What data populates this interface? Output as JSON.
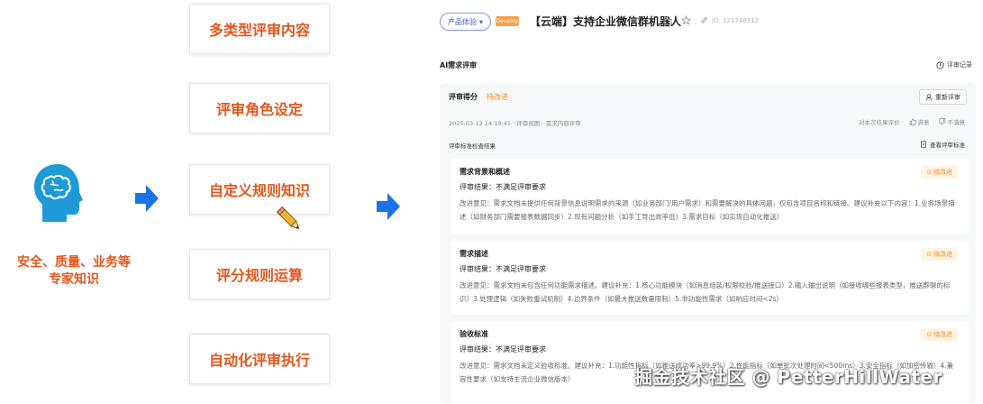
{
  "left": {
    "expert_text": "安全、质量、业务等\n专家知识",
    "steps": [
      "多类型评审内容",
      "评审角色设定",
      "自定义规则知识",
      "评分规则运算",
      "自动化评审执行"
    ]
  },
  "header": {
    "product_tag": "产品体验",
    "status_tag": "Develop",
    "title": "【云端】支持企业微信群机器人",
    "id_text": "ID: 121748312"
  },
  "section": {
    "title": "AI需求评审",
    "history_label": "评审记录"
  },
  "card": {
    "score_label": "评审得分",
    "score_value": "待改进",
    "rerun_label": "重新评审",
    "meta": "2025-03-12 14:19:41 · 评审视图：需求内容评审",
    "feedback_prompt": "对本次结果评价",
    "like_label": "满意",
    "dislike_label": "不满意",
    "check_title": "评审标准检查结果",
    "view_std_label": "查看评审标准"
  },
  "issues": [
    {
      "name": "需求背景和概述",
      "badge": "待改进",
      "result": "评审结果：不满足评审要求",
      "advice": "改进意见：需求文档未提供任何背景信息说明需求的来源（如业务部门/用户需求）和需要解决的具体问题，仅包含项目名称和链接。建议补充以下内容：1.业务场景描述（如财务部门需要报表数据同步）2.现有问题分析（如手工导出效率低）3.需求目标（如实现自动化推送）"
    },
    {
      "name": "需求描述",
      "badge": "待改进",
      "result": "评审结果：不满足评审要求",
      "advice": "改进意见：需求文档未包含任何功能需求描述。建议补充：1.核心功能模块（如消息组装/权限校验/推送接口）2.输入输出说明（如接收哪些报表类型，推送群聊的标识）3.处理逻辑（如失败重试机制）4.边界条件（如最大推送数量限制）5.非功能性需求（如响应时间<2s）"
    },
    {
      "name": "验收标准",
      "badge": "待改进",
      "result": "评审结果：不满足评审要求",
      "advice": "改进意见：需求文档未定义验收标准。建议补充：1.功能性指标（如推送成功率>99.9%）2.性能指标（如单批次处理时间<500ms）3.安全指标（如加密传输）4.兼容性要求（如支持主流企业微信版本）"
    }
  ],
  "watermark": "掘金技术社区 @ PetterHillWater",
  "colors": {
    "accent": "#e2571e",
    "arrow": "#1a73e8",
    "warning": "#f08a24",
    "brain_head": "#1e9bd7"
  }
}
